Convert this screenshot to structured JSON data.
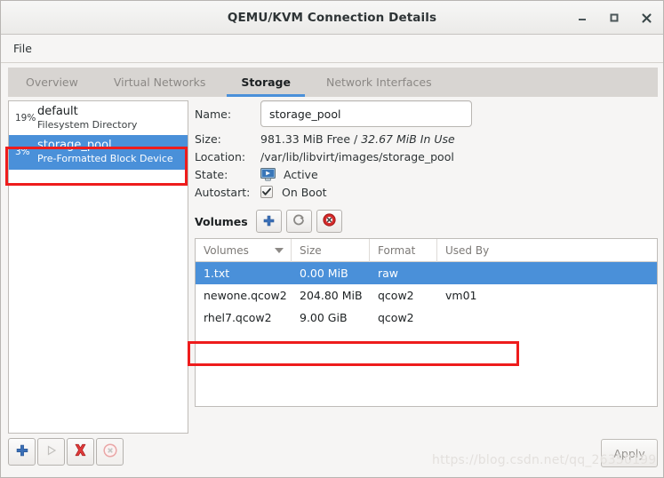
{
  "window": {
    "title": "QEMU/KVM Connection Details",
    "controls": {
      "minimize": "minimize-icon",
      "maximize": "maximize-icon",
      "close": "close-icon"
    }
  },
  "menubar": {
    "items": [
      "File"
    ]
  },
  "tabs": [
    {
      "label": "Overview",
      "active": false
    },
    {
      "label": "Virtual Networks",
      "active": false
    },
    {
      "label": "Storage",
      "active": true
    },
    {
      "label": "Network Interfaces",
      "active": false
    }
  ],
  "sidebar": {
    "pools": [
      {
        "percent": "19%",
        "name": "default",
        "type": "Filesystem Directory",
        "selected": false
      },
      {
        "percent": "3%",
        "name": "storage_pool",
        "type": "Pre-Formatted Block Device",
        "selected": true
      }
    ],
    "toolbar": [
      {
        "name": "add-pool-button",
        "icon": "plus-icon",
        "enabled": true
      },
      {
        "name": "start-pool-button",
        "icon": "play-icon",
        "enabled": false
      },
      {
        "name": "delete-pool-button",
        "icon": "red-x-icon",
        "enabled": true
      },
      {
        "name": "stop-pool-button",
        "icon": "stop-circle-icon",
        "enabled": false
      }
    ]
  },
  "details": {
    "name_label": "Name:",
    "name_value": "storage_pool",
    "size_label": "Size:",
    "size_free": "981.33 MiB Free /",
    "size_inuse": "32.67 MiB In Use",
    "location_label": "Location:",
    "location_value": "/var/lib/libvirt/images/storage_pool",
    "state_label": "State:",
    "state_value": "Active",
    "autostart_label": "Autostart:",
    "autostart_value": "On Boot",
    "autostart_checked": true
  },
  "volumes": {
    "section_title": "Volumes",
    "toolbar": [
      {
        "name": "new-volume-button",
        "icon": "plus-icon"
      },
      {
        "name": "refresh-volumes-button",
        "icon": "refresh-icon"
      },
      {
        "name": "delete-volume-button",
        "icon": "delete-circle-icon"
      }
    ],
    "columns": [
      "Volumes",
      "Size",
      "Format",
      "Used By"
    ],
    "rows": [
      {
        "volume": "1.txt",
        "size": "0.00 MiB",
        "format": "raw",
        "used_by": "",
        "selected": true
      },
      {
        "volume": "newone.qcow2",
        "size": "204.80 MiB",
        "format": "qcow2",
        "used_by": "vm01",
        "selected": false
      },
      {
        "volume": "rhel7.qcow2",
        "size": "9.00 GiB",
        "format": "qcow2",
        "used_by": "",
        "selected": false
      }
    ]
  },
  "footer": {
    "apply_label": "Apply",
    "watermark": "https://blog.csdn.net/qq_26350199"
  },
  "colors": {
    "selection_blue": "#4a90d9",
    "annotation_red": "#ee1c1c",
    "window_bg": "#f6f5f4",
    "tabbar_bg": "#d8d5d2"
  }
}
